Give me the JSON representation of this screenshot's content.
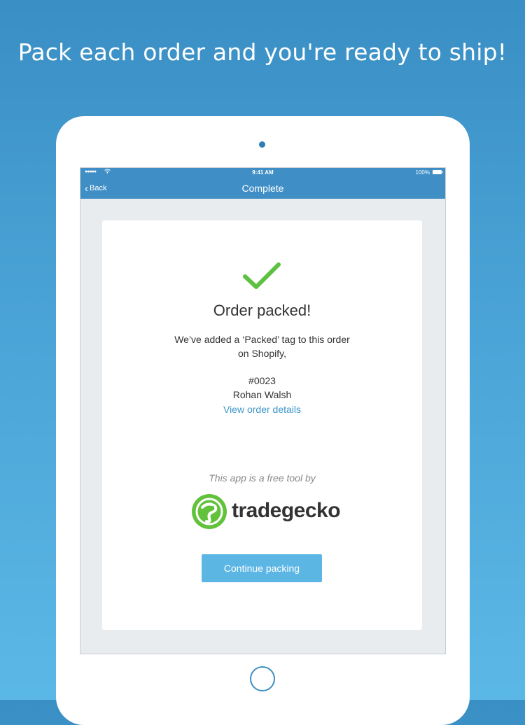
{
  "headline": "Pack each order and you're ready to ship!",
  "status_bar": {
    "signal": "●●●●●",
    "time": "9:41 AM",
    "battery": "100%"
  },
  "nav": {
    "back_label": "Back",
    "title": "Complete"
  },
  "card": {
    "title": "Order packed!",
    "message": "We’ve added a ‘Packed’ tag to this order on Shopify,",
    "order_number": "#0023",
    "customer_name": "Rohan Walsh",
    "view_link": "View order details",
    "free_tool_text": "This app is a free tool by",
    "logo_text": "tradegecko",
    "continue_button": "Continue packing"
  },
  "icons": {
    "check": "check-icon",
    "back": "chevron-left-icon",
    "wifi": "wifi-icon",
    "battery": "battery-icon"
  },
  "colors": {
    "accent_blue": "#3f8fc6",
    "link_blue": "#3f96c9",
    "button_blue": "#5cb6e4",
    "check_green": "#5cc140",
    "gecko_green": "#62c23c"
  }
}
